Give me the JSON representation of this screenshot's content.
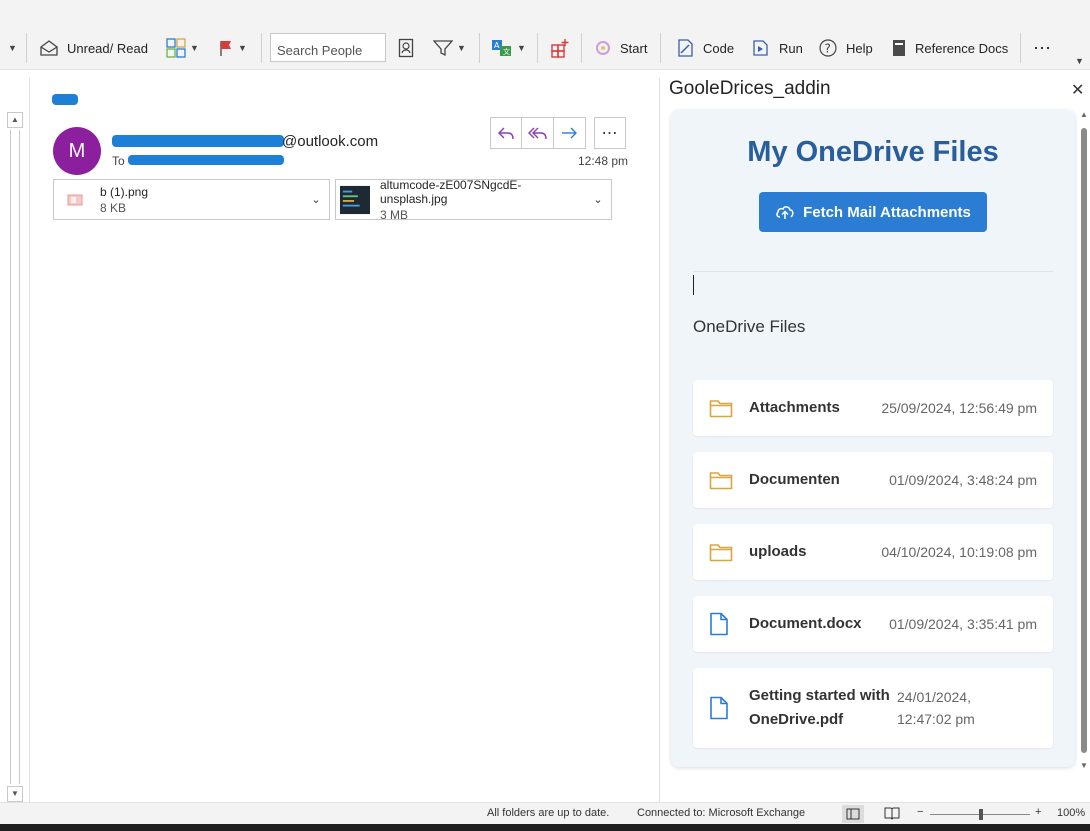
{
  "ribbon": {
    "unread_read": "Unread/ Read",
    "search_people_placeholder": "Search People",
    "start": "Start",
    "code": "Code",
    "run": "Run",
    "help": "Help",
    "reference_docs": "Reference Docs",
    "more": "⋯"
  },
  "message": {
    "avatar_initial": "M",
    "sender_domain": "@outlook.com",
    "to_label": "To",
    "time": "12:48 pm",
    "more": "⋯",
    "attachments": [
      {
        "name": "b (1).png",
        "size": "8 KB"
      },
      {
        "name": "altumcode-zE007SNgcdE-unsplash.jpg",
        "size": "3 MB"
      }
    ]
  },
  "addin": {
    "title": "GooleDrices_addin",
    "close": "✕",
    "heading": "My OneDrive Files",
    "fetch_button": "Fetch Mail Attachments",
    "files_label": "OneDrive Files",
    "files": [
      {
        "name": "Attachments",
        "date": "25/09/2024, 12:56:49 pm",
        "icon": "folder-icon"
      },
      {
        "name": "Documenten",
        "date": "01/09/2024, 3:48:24 pm",
        "icon": "folder-icon"
      },
      {
        "name": "uploads",
        "date": "04/10/2024, 10:19:08 pm",
        "icon": "folder-icon"
      },
      {
        "name": "Document.docx",
        "date": "01/09/2024, 3:35:41 pm",
        "icon": "document-icon"
      },
      {
        "name": "Getting started with OneDrive.pdf",
        "date": "24/01/2024, 12:47:02 pm",
        "icon": "document-icon"
      }
    ]
  },
  "status": {
    "sync": "All folders are up to date.",
    "connection": "Connected to: Microsoft Exchange",
    "zoom": "100%",
    "zoom_minus": "−",
    "zoom_plus": "+"
  },
  "colors": {
    "accent": "#2b7cd3",
    "heading": "#2a5e9a",
    "avatar": "#8b1f9e",
    "folder": "#d9a441",
    "redaction": "#1e7fd6"
  }
}
